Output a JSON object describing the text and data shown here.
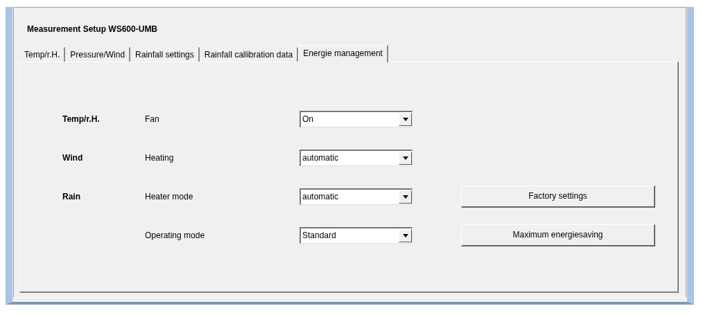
{
  "heading": "Measurement Setup  WS600-UMB",
  "tabs": [
    {
      "label": "Temp/r.H.",
      "selected": false
    },
    {
      "label": "Pressure/Wind",
      "selected": false
    },
    {
      "label": "Rainfall settings",
      "selected": false
    },
    {
      "label": "Rainfall callibration data",
      "selected": false
    },
    {
      "label": "Energie management",
      "selected": true
    }
  ],
  "rows": [
    {
      "group": "Temp/r.H.",
      "label": "Fan",
      "value": "On"
    },
    {
      "group": "Wind",
      "label": "Heating",
      "value": "automatic"
    },
    {
      "group": "Rain",
      "label": "Heater mode",
      "value": "automatic",
      "button": "Factory settings"
    },
    {
      "label": "Operating mode",
      "value": "Standard",
      "button": "Maximum energiesaving"
    }
  ]
}
